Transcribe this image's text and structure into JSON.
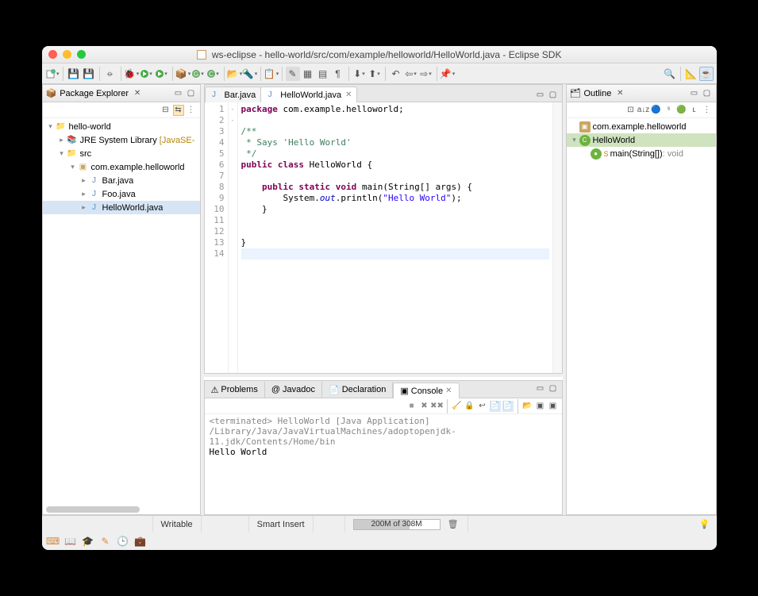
{
  "title": "ws-eclipse - hello-world/src/com/example/helloworld/HelloWorld.java - Eclipse SDK",
  "views": {
    "package_explorer": {
      "title": "Package Explorer"
    },
    "outline": {
      "title": "Outline"
    }
  },
  "project_tree": {
    "project": "hello-world",
    "jre_label": "JRE System Library",
    "jre_decor": "[JavaSE-",
    "src": "src",
    "package": "com.example.helloworld",
    "files": [
      "Bar.java",
      "Foo.java",
      "HelloWorld.java"
    ]
  },
  "editor": {
    "tabs": [
      "Bar.java",
      "HelloWorld.java"
    ],
    "active_tab": 1,
    "line_count": 14,
    "code_lines": [
      {
        "n": 1,
        "tokens": [
          [
            "kw",
            "package"
          ],
          [
            "",
            " com.example.helloworld;"
          ]
        ]
      },
      {
        "n": 2,
        "tokens": []
      },
      {
        "n": 3,
        "fold": "-",
        "tokens": [
          [
            "cm",
            "/**"
          ]
        ]
      },
      {
        "n": 4,
        "tokens": [
          [
            "cm",
            " * Says 'Hello World'"
          ]
        ]
      },
      {
        "n": 5,
        "tokens": [
          [
            "cm",
            " */"
          ]
        ]
      },
      {
        "n": 6,
        "tokens": [
          [
            "kw",
            "public"
          ],
          [
            "",
            " "
          ],
          [
            "kw",
            "class"
          ],
          [
            "",
            " HelloWorld {"
          ]
        ]
      },
      {
        "n": 7,
        "tokens": []
      },
      {
        "n": 8,
        "fold": "-",
        "tokens": [
          [
            "",
            "    "
          ],
          [
            "kw",
            "public"
          ],
          [
            "",
            " "
          ],
          [
            "kw",
            "static"
          ],
          [
            "",
            " "
          ],
          [
            "kw",
            "void"
          ],
          [
            "",
            " main(String[] args) {"
          ]
        ]
      },
      {
        "n": 9,
        "tokens": [
          [
            "",
            "        System."
          ],
          [
            "fld",
            "out"
          ],
          [
            "",
            ".println("
          ],
          [
            "str",
            "\"Hello World\""
          ],
          [
            "",
            ");"
          ]
        ]
      },
      {
        "n": 10,
        "tokens": [
          [
            "",
            "    }"
          ]
        ]
      },
      {
        "n": 11,
        "tokens": []
      },
      {
        "n": 12,
        "tokens": []
      },
      {
        "n": 13,
        "tokens": [
          [
            "",
            "}"
          ]
        ]
      },
      {
        "n": 14,
        "tokens": [],
        "current": true
      }
    ]
  },
  "bottom_tabs": {
    "items": [
      "Problems",
      "Javadoc",
      "Declaration",
      "Console"
    ],
    "active": 3
  },
  "console": {
    "header": "<terminated> HelloWorld [Java Application] /Library/Java/JavaVirtualMachines/adoptopenjdk-11.jdk/Contents/Home/bin",
    "output": "Hello World"
  },
  "outline": {
    "package": "com.example.helloworld",
    "class": "HelloWorld",
    "method": "main(String[])",
    "method_ret": ": void"
  },
  "status": {
    "writable": "Writable",
    "insert": "Smart Insert",
    "heap": "200M of 308M",
    "heap_pct": 65
  }
}
